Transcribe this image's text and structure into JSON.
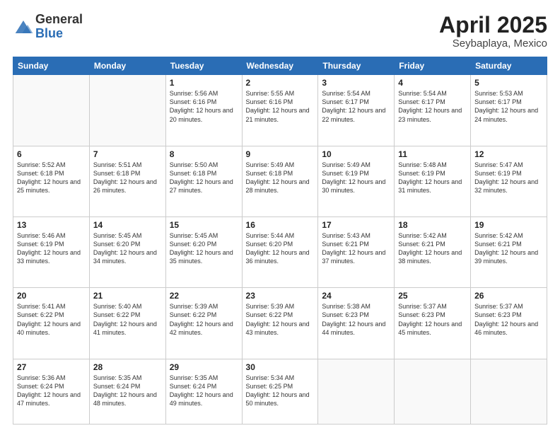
{
  "logo": {
    "general": "General",
    "blue": "Blue"
  },
  "title": "April 2025",
  "location": "Seybaplaya, Mexico",
  "days_of_week": [
    "Sunday",
    "Monday",
    "Tuesday",
    "Wednesday",
    "Thursday",
    "Friday",
    "Saturday"
  ],
  "weeks": [
    [
      {
        "day": "",
        "info": ""
      },
      {
        "day": "",
        "info": ""
      },
      {
        "day": "1",
        "info": "Sunrise: 5:56 AM\nSunset: 6:16 PM\nDaylight: 12 hours and 20 minutes."
      },
      {
        "day": "2",
        "info": "Sunrise: 5:55 AM\nSunset: 6:16 PM\nDaylight: 12 hours and 21 minutes."
      },
      {
        "day": "3",
        "info": "Sunrise: 5:54 AM\nSunset: 6:17 PM\nDaylight: 12 hours and 22 minutes."
      },
      {
        "day": "4",
        "info": "Sunrise: 5:54 AM\nSunset: 6:17 PM\nDaylight: 12 hours and 23 minutes."
      },
      {
        "day": "5",
        "info": "Sunrise: 5:53 AM\nSunset: 6:17 PM\nDaylight: 12 hours and 24 minutes."
      }
    ],
    [
      {
        "day": "6",
        "info": "Sunrise: 5:52 AM\nSunset: 6:18 PM\nDaylight: 12 hours and 25 minutes."
      },
      {
        "day": "7",
        "info": "Sunrise: 5:51 AM\nSunset: 6:18 PM\nDaylight: 12 hours and 26 minutes."
      },
      {
        "day": "8",
        "info": "Sunrise: 5:50 AM\nSunset: 6:18 PM\nDaylight: 12 hours and 27 minutes."
      },
      {
        "day": "9",
        "info": "Sunrise: 5:49 AM\nSunset: 6:18 PM\nDaylight: 12 hours and 28 minutes."
      },
      {
        "day": "10",
        "info": "Sunrise: 5:49 AM\nSunset: 6:19 PM\nDaylight: 12 hours and 30 minutes."
      },
      {
        "day": "11",
        "info": "Sunrise: 5:48 AM\nSunset: 6:19 PM\nDaylight: 12 hours and 31 minutes."
      },
      {
        "day": "12",
        "info": "Sunrise: 5:47 AM\nSunset: 6:19 PM\nDaylight: 12 hours and 32 minutes."
      }
    ],
    [
      {
        "day": "13",
        "info": "Sunrise: 5:46 AM\nSunset: 6:19 PM\nDaylight: 12 hours and 33 minutes."
      },
      {
        "day": "14",
        "info": "Sunrise: 5:45 AM\nSunset: 6:20 PM\nDaylight: 12 hours and 34 minutes."
      },
      {
        "day": "15",
        "info": "Sunrise: 5:45 AM\nSunset: 6:20 PM\nDaylight: 12 hours and 35 minutes."
      },
      {
        "day": "16",
        "info": "Sunrise: 5:44 AM\nSunset: 6:20 PM\nDaylight: 12 hours and 36 minutes."
      },
      {
        "day": "17",
        "info": "Sunrise: 5:43 AM\nSunset: 6:21 PM\nDaylight: 12 hours and 37 minutes."
      },
      {
        "day": "18",
        "info": "Sunrise: 5:42 AM\nSunset: 6:21 PM\nDaylight: 12 hours and 38 minutes."
      },
      {
        "day": "19",
        "info": "Sunrise: 5:42 AM\nSunset: 6:21 PM\nDaylight: 12 hours and 39 minutes."
      }
    ],
    [
      {
        "day": "20",
        "info": "Sunrise: 5:41 AM\nSunset: 6:22 PM\nDaylight: 12 hours and 40 minutes."
      },
      {
        "day": "21",
        "info": "Sunrise: 5:40 AM\nSunset: 6:22 PM\nDaylight: 12 hours and 41 minutes."
      },
      {
        "day": "22",
        "info": "Sunrise: 5:39 AM\nSunset: 6:22 PM\nDaylight: 12 hours and 42 minutes."
      },
      {
        "day": "23",
        "info": "Sunrise: 5:39 AM\nSunset: 6:22 PM\nDaylight: 12 hours and 43 minutes."
      },
      {
        "day": "24",
        "info": "Sunrise: 5:38 AM\nSunset: 6:23 PM\nDaylight: 12 hours and 44 minutes."
      },
      {
        "day": "25",
        "info": "Sunrise: 5:37 AM\nSunset: 6:23 PM\nDaylight: 12 hours and 45 minutes."
      },
      {
        "day": "26",
        "info": "Sunrise: 5:37 AM\nSunset: 6:23 PM\nDaylight: 12 hours and 46 minutes."
      }
    ],
    [
      {
        "day": "27",
        "info": "Sunrise: 5:36 AM\nSunset: 6:24 PM\nDaylight: 12 hours and 47 minutes."
      },
      {
        "day": "28",
        "info": "Sunrise: 5:35 AM\nSunset: 6:24 PM\nDaylight: 12 hours and 48 minutes."
      },
      {
        "day": "29",
        "info": "Sunrise: 5:35 AM\nSunset: 6:24 PM\nDaylight: 12 hours and 49 minutes."
      },
      {
        "day": "30",
        "info": "Sunrise: 5:34 AM\nSunset: 6:25 PM\nDaylight: 12 hours and 50 minutes."
      },
      {
        "day": "",
        "info": ""
      },
      {
        "day": "",
        "info": ""
      },
      {
        "day": "",
        "info": ""
      }
    ]
  ]
}
